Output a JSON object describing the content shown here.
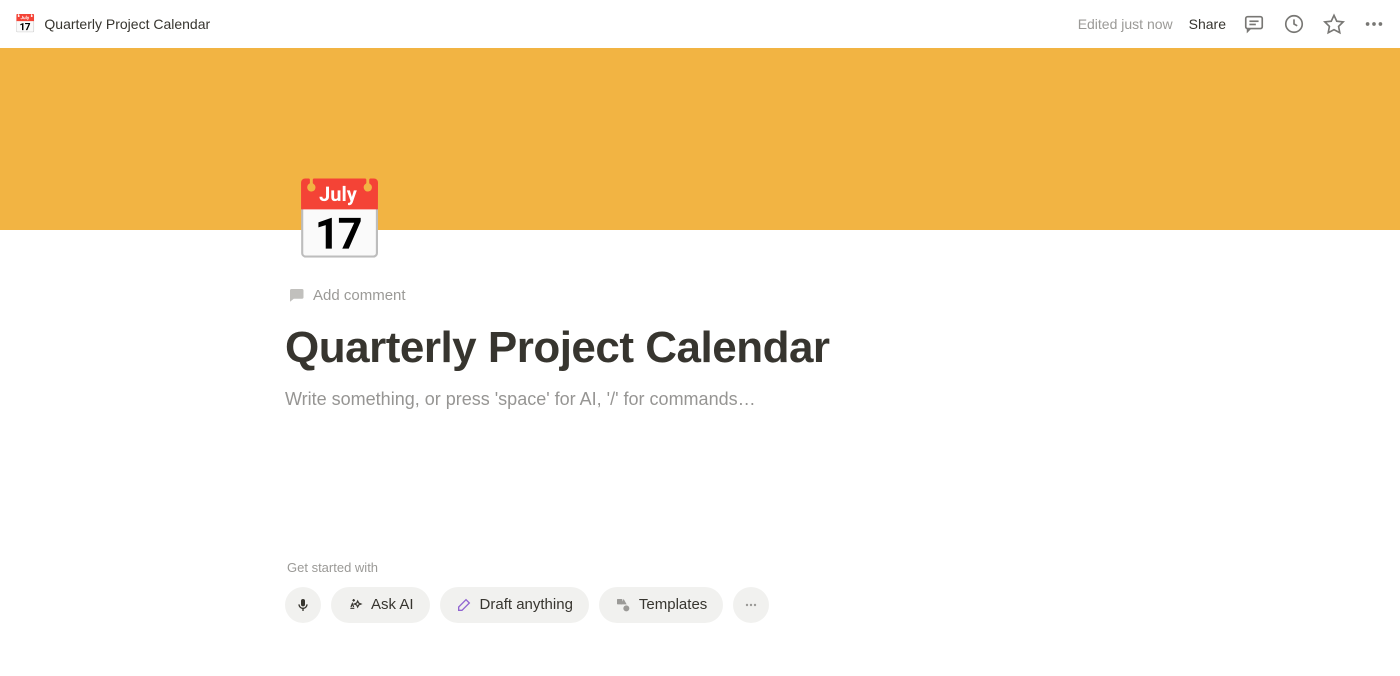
{
  "topbar": {
    "icon": "📅",
    "title": "Quarterly Project Calendar",
    "edited": "Edited just now",
    "share": "Share"
  },
  "page": {
    "icon": "📅",
    "add_comment": "Add comment",
    "title": "Quarterly Project Calendar",
    "placeholder": "Write something, or press 'space' for AI, '/' for commands…",
    "get_started_label": "Get started with",
    "actions": {
      "ask_ai": "Ask AI",
      "draft": "Draft anything",
      "templates": "Templates"
    }
  }
}
